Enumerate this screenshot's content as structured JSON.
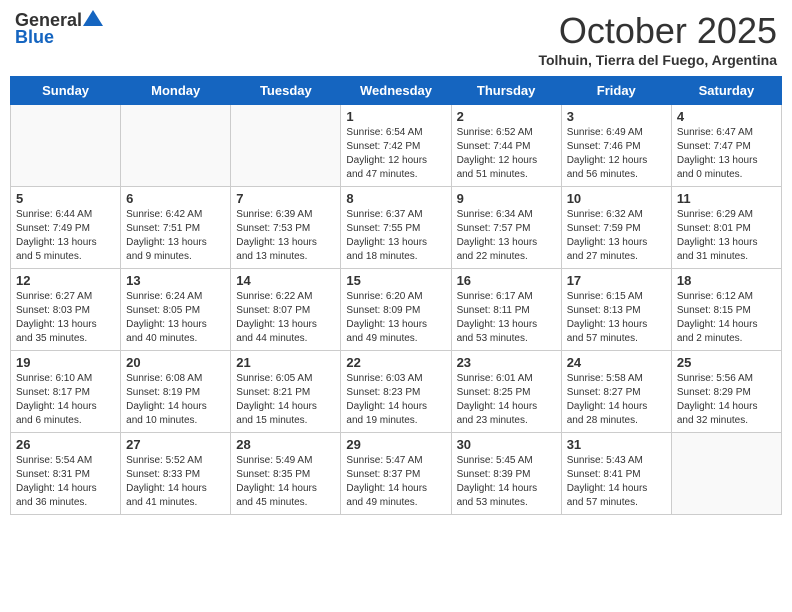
{
  "header": {
    "logo_general": "General",
    "logo_blue": "Blue",
    "month_title": "October 2025",
    "location": "Tolhuin, Tierra del Fuego, Argentina"
  },
  "days_of_week": [
    "Sunday",
    "Monday",
    "Tuesday",
    "Wednesday",
    "Thursday",
    "Friday",
    "Saturday"
  ],
  "weeks": [
    [
      {
        "day": "",
        "info": ""
      },
      {
        "day": "",
        "info": ""
      },
      {
        "day": "",
        "info": ""
      },
      {
        "day": "1",
        "info": "Sunrise: 6:54 AM\nSunset: 7:42 PM\nDaylight: 12 hours\nand 47 minutes."
      },
      {
        "day": "2",
        "info": "Sunrise: 6:52 AM\nSunset: 7:44 PM\nDaylight: 12 hours\nand 51 minutes."
      },
      {
        "day": "3",
        "info": "Sunrise: 6:49 AM\nSunset: 7:46 PM\nDaylight: 12 hours\nand 56 minutes."
      },
      {
        "day": "4",
        "info": "Sunrise: 6:47 AM\nSunset: 7:47 PM\nDaylight: 13 hours\nand 0 minutes."
      }
    ],
    [
      {
        "day": "5",
        "info": "Sunrise: 6:44 AM\nSunset: 7:49 PM\nDaylight: 13 hours\nand 5 minutes."
      },
      {
        "day": "6",
        "info": "Sunrise: 6:42 AM\nSunset: 7:51 PM\nDaylight: 13 hours\nand 9 minutes."
      },
      {
        "day": "7",
        "info": "Sunrise: 6:39 AM\nSunset: 7:53 PM\nDaylight: 13 hours\nand 13 minutes."
      },
      {
        "day": "8",
        "info": "Sunrise: 6:37 AM\nSunset: 7:55 PM\nDaylight: 13 hours\nand 18 minutes."
      },
      {
        "day": "9",
        "info": "Sunrise: 6:34 AM\nSunset: 7:57 PM\nDaylight: 13 hours\nand 22 minutes."
      },
      {
        "day": "10",
        "info": "Sunrise: 6:32 AM\nSunset: 7:59 PM\nDaylight: 13 hours\nand 27 minutes."
      },
      {
        "day": "11",
        "info": "Sunrise: 6:29 AM\nSunset: 8:01 PM\nDaylight: 13 hours\nand 31 minutes."
      }
    ],
    [
      {
        "day": "12",
        "info": "Sunrise: 6:27 AM\nSunset: 8:03 PM\nDaylight: 13 hours\nand 35 minutes."
      },
      {
        "day": "13",
        "info": "Sunrise: 6:24 AM\nSunset: 8:05 PM\nDaylight: 13 hours\nand 40 minutes."
      },
      {
        "day": "14",
        "info": "Sunrise: 6:22 AM\nSunset: 8:07 PM\nDaylight: 13 hours\nand 44 minutes."
      },
      {
        "day": "15",
        "info": "Sunrise: 6:20 AM\nSunset: 8:09 PM\nDaylight: 13 hours\nand 49 minutes."
      },
      {
        "day": "16",
        "info": "Sunrise: 6:17 AM\nSunset: 8:11 PM\nDaylight: 13 hours\nand 53 minutes."
      },
      {
        "day": "17",
        "info": "Sunrise: 6:15 AM\nSunset: 8:13 PM\nDaylight: 13 hours\nand 57 minutes."
      },
      {
        "day": "18",
        "info": "Sunrise: 6:12 AM\nSunset: 8:15 PM\nDaylight: 14 hours\nand 2 minutes."
      }
    ],
    [
      {
        "day": "19",
        "info": "Sunrise: 6:10 AM\nSunset: 8:17 PM\nDaylight: 14 hours\nand 6 minutes."
      },
      {
        "day": "20",
        "info": "Sunrise: 6:08 AM\nSunset: 8:19 PM\nDaylight: 14 hours\nand 10 minutes."
      },
      {
        "day": "21",
        "info": "Sunrise: 6:05 AM\nSunset: 8:21 PM\nDaylight: 14 hours\nand 15 minutes."
      },
      {
        "day": "22",
        "info": "Sunrise: 6:03 AM\nSunset: 8:23 PM\nDaylight: 14 hours\nand 19 minutes."
      },
      {
        "day": "23",
        "info": "Sunrise: 6:01 AM\nSunset: 8:25 PM\nDaylight: 14 hours\nand 23 minutes."
      },
      {
        "day": "24",
        "info": "Sunrise: 5:58 AM\nSunset: 8:27 PM\nDaylight: 14 hours\nand 28 minutes."
      },
      {
        "day": "25",
        "info": "Sunrise: 5:56 AM\nSunset: 8:29 PM\nDaylight: 14 hours\nand 32 minutes."
      }
    ],
    [
      {
        "day": "26",
        "info": "Sunrise: 5:54 AM\nSunset: 8:31 PM\nDaylight: 14 hours\nand 36 minutes."
      },
      {
        "day": "27",
        "info": "Sunrise: 5:52 AM\nSunset: 8:33 PM\nDaylight: 14 hours\nand 41 minutes."
      },
      {
        "day": "28",
        "info": "Sunrise: 5:49 AM\nSunset: 8:35 PM\nDaylight: 14 hours\nand 45 minutes."
      },
      {
        "day": "29",
        "info": "Sunrise: 5:47 AM\nSunset: 8:37 PM\nDaylight: 14 hours\nand 49 minutes."
      },
      {
        "day": "30",
        "info": "Sunrise: 5:45 AM\nSunset: 8:39 PM\nDaylight: 14 hours\nand 53 minutes."
      },
      {
        "day": "31",
        "info": "Sunrise: 5:43 AM\nSunset: 8:41 PM\nDaylight: 14 hours\nand 57 minutes."
      },
      {
        "day": "",
        "info": ""
      }
    ]
  ]
}
